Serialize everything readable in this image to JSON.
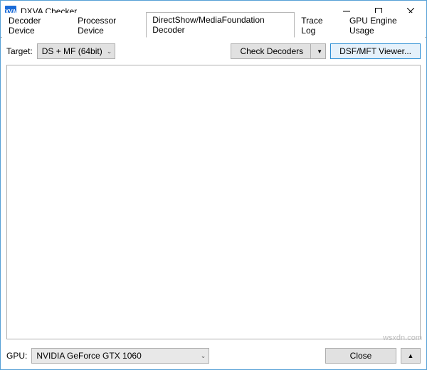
{
  "window": {
    "title": "DXVA Checker",
    "icon_text": "XVA"
  },
  "tabs": [
    {
      "label": "Decoder Device",
      "active": false
    },
    {
      "label": "Processor Device",
      "active": false
    },
    {
      "label": "DirectShow/MediaFoundation Decoder",
      "active": true
    },
    {
      "label": "Trace Log",
      "active": false
    },
    {
      "label": "GPU Engine Usage",
      "active": false
    }
  ],
  "toolbar": {
    "target_label": "Target:",
    "target_value": "DS + MF (64bit)",
    "check_decoders_label": "Check Decoders",
    "dsf_viewer_label": "DSF/MFT Viewer..."
  },
  "footer": {
    "gpu_label": "GPU:",
    "gpu_value": "NVIDIA GeForce GTX 1060",
    "close_label": "Close"
  },
  "watermark": "wsxdn.com"
}
